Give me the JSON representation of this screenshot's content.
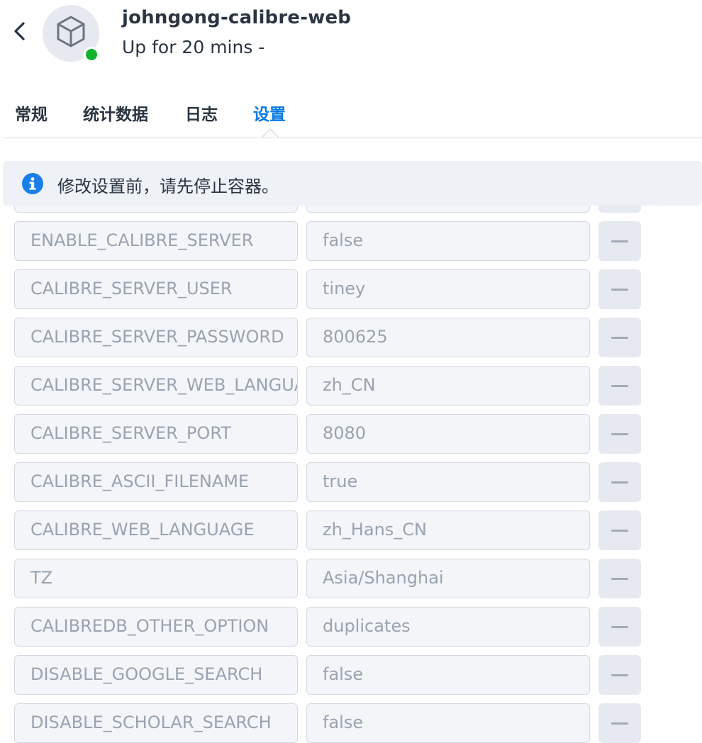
{
  "header": {
    "title": "johngong-calibre-web",
    "status": "Up for 20 mins -",
    "status_color": "#12b12b"
  },
  "tabs": [
    {
      "label": "常规",
      "active": false
    },
    {
      "label": "统计数据",
      "active": false
    },
    {
      "label": "日志",
      "active": false
    },
    {
      "label": "设置",
      "active": true
    }
  ],
  "accent_color": "#0a7ae6",
  "info_banner": {
    "icon": "info-icon",
    "text": "修改设置前，请先停止容器。"
  },
  "env_vars": [
    {
      "key": "",
      "value": ""
    },
    {
      "key": "ENABLE_CALIBRE_SERVER",
      "value": "false"
    },
    {
      "key": "CALIBRE_SERVER_USER",
      "value": "tiney"
    },
    {
      "key": "CALIBRE_SERVER_PASSWORD",
      "value": "800625"
    },
    {
      "key": "CALIBRE_SERVER_WEB_LANGUAGE",
      "value": "zh_CN"
    },
    {
      "key": "CALIBRE_SERVER_PORT",
      "value": "8080"
    },
    {
      "key": "CALIBRE_ASCII_FILENAME",
      "value": "true"
    },
    {
      "key": "CALIBRE_WEB_LANGUAGE",
      "value": "zh_Hans_CN"
    },
    {
      "key": "TZ",
      "value": "Asia/Shanghai"
    },
    {
      "key": "CALIBREDB_OTHER_OPTION",
      "value": "duplicates"
    },
    {
      "key": "DISABLE_GOOGLE_SEARCH",
      "value": "false"
    },
    {
      "key": "DISABLE_SCHOLAR_SEARCH",
      "value": "false"
    }
  ]
}
